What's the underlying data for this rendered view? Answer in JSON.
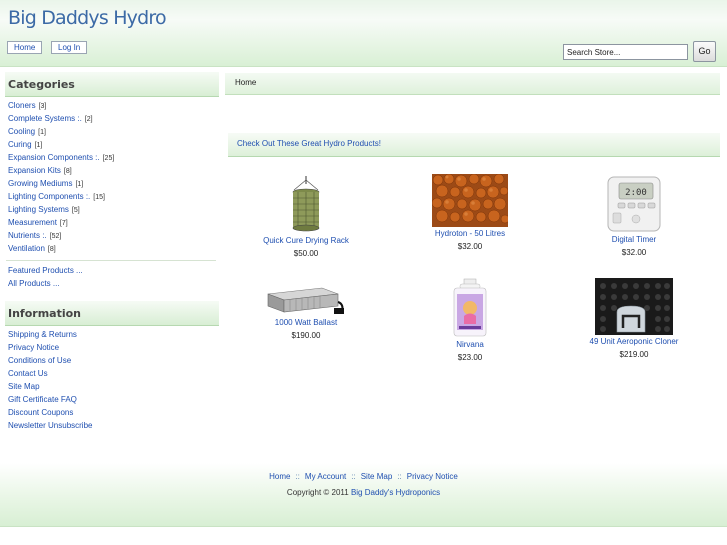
{
  "header": {
    "logo": "Big Daddys Hydro",
    "nav": {
      "home": "Home",
      "login": "Log In"
    },
    "search": {
      "value": "Search Store...",
      "button": "Go"
    }
  },
  "categories": {
    "heading": "Categories",
    "items": [
      {
        "label": "Cloners",
        "count": "[3]"
      },
      {
        "label": "Complete Systems :.",
        "count": "[2]"
      },
      {
        "label": "Cooling",
        "count": "[1]"
      },
      {
        "label": "Curing",
        "count": "[1]"
      },
      {
        "label": "Expansion Components :.",
        "count": "[25]"
      },
      {
        "label": "Expansion Kits",
        "count": "[8]"
      },
      {
        "label": "Growing Mediums",
        "count": "[1]"
      },
      {
        "label": "Lighting Components :.",
        "count": "[15]"
      },
      {
        "label": "Lighting Systems",
        "count": "[5]"
      },
      {
        "label": "Measurement",
        "count": "[7]"
      },
      {
        "label": "Nutrients :.",
        "count": "[52]"
      },
      {
        "label": "Ventilation",
        "count": "[8]"
      }
    ],
    "extra": [
      "Featured Products ...",
      "All Products ..."
    ]
  },
  "information": {
    "heading": "Information",
    "items": [
      "Shipping & Returns",
      "Privacy Notice",
      "Conditions of Use",
      "Contact Us",
      "Site Map",
      "Gift Certificate FAQ",
      "Discount Coupons",
      "Newsletter Unsubscribe"
    ]
  },
  "main": {
    "breadcrumb": "Home",
    "products_heading": "Check Out These Great Hydro Products!",
    "products": [
      {
        "name": "Quick Cure Drying Rack",
        "price": "$50.00",
        "icon": "drying-rack"
      },
      {
        "name": "Hydroton - 50 Litres",
        "price": "$32.00",
        "icon": "clay-pebbles"
      },
      {
        "name": "Digital Timer",
        "price": "$32.00",
        "icon": "digital-timer"
      },
      {
        "name": "1000 Watt Ballast",
        "price": "$190.00",
        "icon": "ballast"
      },
      {
        "name": "Nirvana",
        "price": "$23.00",
        "icon": "nutrient-bottle"
      },
      {
        "name": "49 Unit Aeroponic Cloner",
        "price": "$219.00",
        "icon": "cloner"
      }
    ]
  },
  "footer": {
    "links": [
      "Home",
      "My Account",
      "Site Map",
      "Privacy Notice"
    ],
    "separator": "::",
    "copyright_prefix": "Copyright © 2011 ",
    "copyright_link": "Big Daddy's Hydroponics"
  },
  "colors": {
    "link": "#1f4fb0",
    "logo": "#3c6aa6",
    "bar_green": "#d8eed4"
  }
}
